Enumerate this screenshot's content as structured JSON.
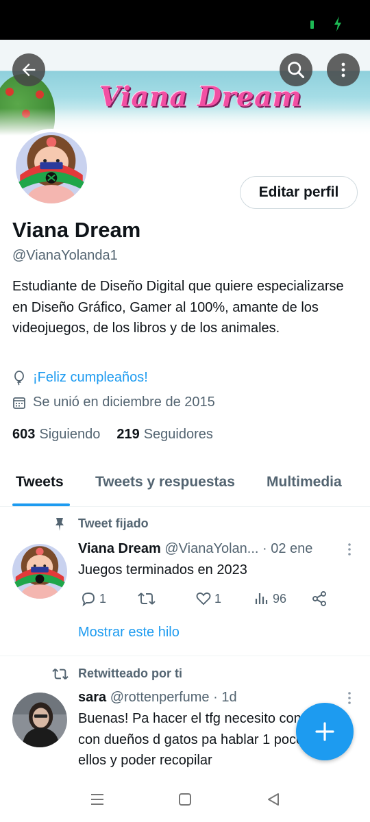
{
  "profile": {
    "banner_title": "Viana Dream",
    "name": "Viana Dream",
    "handle": "@VianaYolanda1",
    "edit_label": "Editar perfil",
    "bio": "Estudiante de Diseño Digital que quiere especializarse en Diseño Gráfico, Gamer al 100%, amante de los videojuegos, de los libros y de los animales.",
    "birthday": "¡Feliz cumpleaños!",
    "joined": "Se unió en diciembre de 2015",
    "following_count": "603",
    "following_label": "Siguiendo",
    "followers_count": "219",
    "followers_label": "Seguidores"
  },
  "tabs": [
    {
      "label": "Tweets",
      "active": true
    },
    {
      "label": "Tweets y respuestas",
      "active": false
    },
    {
      "label": "Multimedia",
      "active": false
    }
  ],
  "tweets": [
    {
      "context": "Tweet fijado",
      "name": "Viana Dream",
      "handle": "@VianaYolan...",
      "date": "· 02 ene",
      "text": "Juegos terminados en 2023",
      "replies": "1",
      "likes": "1",
      "views": "96",
      "show_thread": "Mostrar este hilo"
    },
    {
      "context": "Retwitteado por ti",
      "name": "sara",
      "handle": "@rottenperfume",
      "date": "· 1d",
      "text": "Buenas! Pa hacer el tfg necesito contactar con dueños d gatos pa hablar 1 poco con ellos y poder recopilar"
    }
  ],
  "icons": {
    "back": "arrow-left-icon",
    "search": "search-icon",
    "more": "more-vertical-icon",
    "balloon": "balloon-icon",
    "calendar": "calendar-icon",
    "pin": "pin-icon",
    "retweet": "retweet-icon",
    "reply": "reply-icon",
    "like": "heart-icon",
    "views": "views-icon",
    "share": "share-icon",
    "compose": "plus-icon"
  },
  "colors": {
    "accent": "#1d9bf0",
    "text": "#0f1419",
    "secondary": "#536471",
    "banner_title": "#f24fa3"
  }
}
